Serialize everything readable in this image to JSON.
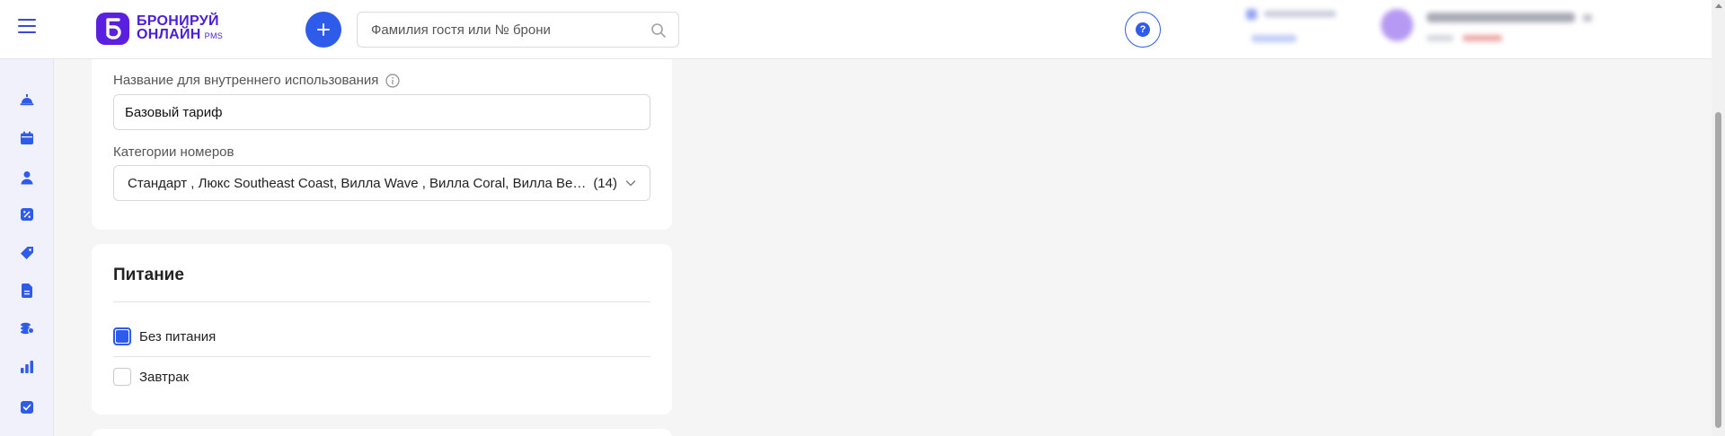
{
  "header": {
    "logo": {
      "line1": "БРОНИРУЙ",
      "line2": "ОНЛАЙН",
      "suffix": "PMS"
    },
    "search": {
      "placeholder": "Фамилия гостя или № брони",
      "value": ""
    },
    "help_glyph": "?"
  },
  "sidebar": {
    "icons": [
      "bell-icon",
      "calendar-icon",
      "user-icon",
      "percent-icon",
      "tag-icon",
      "document-icon",
      "coins-icon",
      "bar-chart-icon",
      "checkbox-icon"
    ]
  },
  "rate_form": {
    "internal_name_label": "Название для внутреннего использования",
    "internal_name_value": "Базовый тариф",
    "room_categories_label": "Категории номеров",
    "room_categories_value": "Стандарт , Люкс Southeast Coast, Вилла Wave , Вилла Coral, Вилла Beach, Вилла Sunset",
    "room_categories_count": "(14)"
  },
  "meals": {
    "title": "Питание",
    "options": [
      {
        "label": "Без питания",
        "checked": true
      },
      {
        "label": "Завтрак",
        "checked": false
      }
    ]
  },
  "colors": {
    "accent": "#2f5bea",
    "brand": "#5a1fe0",
    "sidebar_bg": "#f0f1fb",
    "page_bg": "#f5f5f5"
  }
}
